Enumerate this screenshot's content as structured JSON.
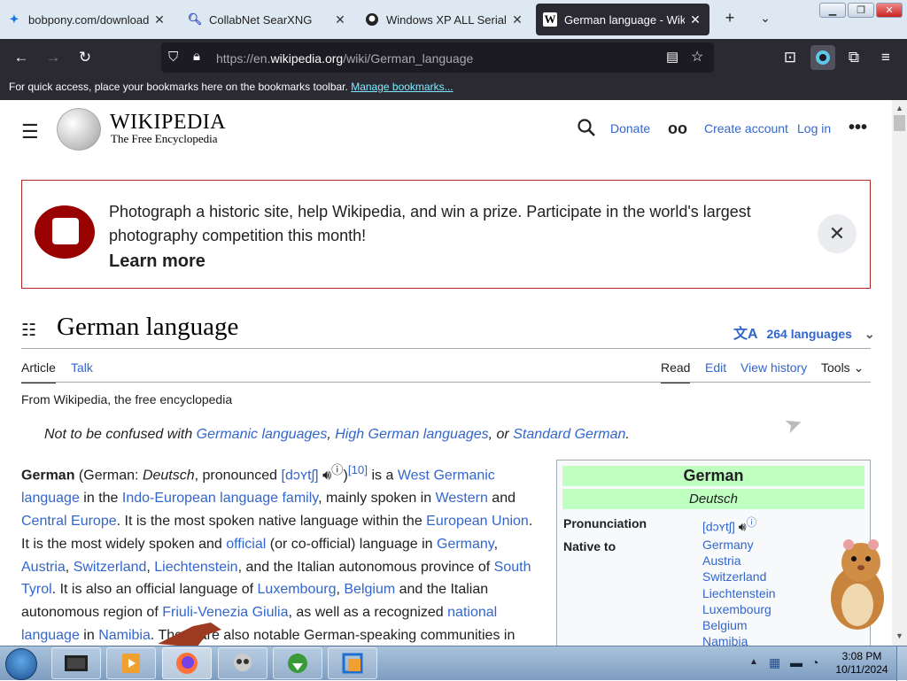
{
  "browser": {
    "tabs": [
      {
        "title": "bobpony.com/downloads/",
        "icon": "bobpony-icon"
      },
      {
        "title": "CollabNet SearXNG",
        "icon": "search-icon"
      },
      {
        "title": "Windows XP ALL Serial Key",
        "icon": "github-icon"
      },
      {
        "title": "German language - Wikipe",
        "icon": "wikipedia-icon",
        "active": true
      }
    ],
    "url_prefix": "https://en.",
    "url_domain": "wikipedia.org",
    "url_path": "/wiki/German_language",
    "bookmarks_text": "For quick access, place your bookmarks here on the bookmarks toolbar.",
    "bookmarks_link": "Manage bookmarks..."
  },
  "wiki": {
    "wordmark": "WIKIPEDIA",
    "tagline": "The Free Encyclopedia",
    "donate": "Donate",
    "create_account": "Create account",
    "login": "Log in",
    "banner_text": "Photograph a historic site, help Wikipedia, and win a prize. Participate in the world's largest photography competition this month!",
    "banner_more": "Learn more",
    "title": "German language",
    "languages": "264 languages",
    "tabs": {
      "article": "Article",
      "talk": "Talk",
      "read": "Read",
      "edit": "Edit",
      "history": "View history",
      "tools": "Tools"
    },
    "from": "From Wikipedia, the free encyclopedia",
    "hatnote_prefix": "Not to be confused with",
    "hatnote_l1": "Germanic languages",
    "hatnote_l2": "High German languages",
    "hatnote_or": "or",
    "hatnote_l3": "Standard German"
  },
  "infobox": {
    "title": "German",
    "native": "Deutsch",
    "pron_label": "Pronunciation",
    "pron": "[dɔʏtʃ]",
    "native_label": "Native to",
    "native_to": [
      "Germany",
      "Austria",
      "Switzerland",
      "Liechtenstein",
      "Luxembourg",
      "Belgium",
      "Namibia"
    ]
  },
  "taskbar": {
    "time": "3:08 PM",
    "date": "10/11/2024"
  }
}
